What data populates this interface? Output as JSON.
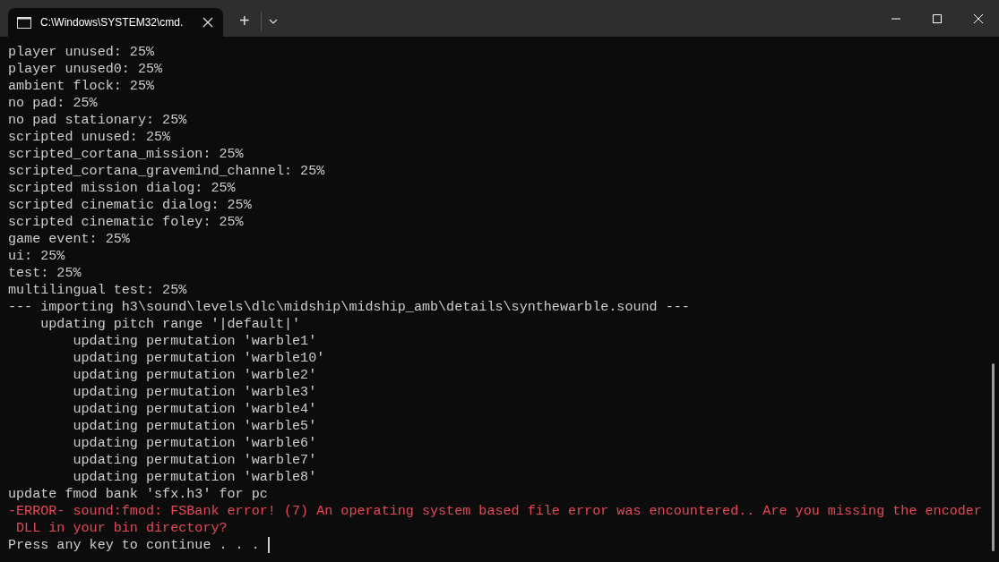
{
  "window": {
    "tab_title": "C:\\Windows\\SYSTEM32\\cmd.",
    "new_tab": "+"
  },
  "lines": [
    {
      "kind": "output",
      "text": "player unused: 25%"
    },
    {
      "kind": "output",
      "text": "player unused0: 25%"
    },
    {
      "kind": "output",
      "text": "ambient flock: 25%"
    },
    {
      "kind": "output",
      "text": "no pad: 25%"
    },
    {
      "kind": "output",
      "text": "no pad stationary: 25%"
    },
    {
      "kind": "output",
      "text": "scripted unused: 25%"
    },
    {
      "kind": "output",
      "text": "scripted_cortana_mission: 25%"
    },
    {
      "kind": "output",
      "text": "scripted_cortana_gravemind_channel: 25%"
    },
    {
      "kind": "output",
      "text": "scripted mission dialog: 25%"
    },
    {
      "kind": "output",
      "text": "scripted cinematic dialog: 25%"
    },
    {
      "kind": "output",
      "text": "scripted cinematic foley: 25%"
    },
    {
      "kind": "output",
      "text": "game event: 25%"
    },
    {
      "kind": "output",
      "text": "ui: 25%"
    },
    {
      "kind": "output",
      "text": "test: 25%"
    },
    {
      "kind": "output",
      "text": "multilingual test: 25%"
    },
    {
      "kind": "output",
      "text": "--- importing h3\\sound\\levels\\dlc\\midship\\midship_amb\\details\\synthewarble.sound ---"
    },
    {
      "kind": "output",
      "text": "    updating pitch range '|default|'"
    },
    {
      "kind": "output",
      "text": "        updating permutation 'warble1'"
    },
    {
      "kind": "output",
      "text": "        updating permutation 'warble10'"
    },
    {
      "kind": "output",
      "text": "        updating permutation 'warble2'"
    },
    {
      "kind": "output",
      "text": "        updating permutation 'warble3'"
    },
    {
      "kind": "output",
      "text": "        updating permutation 'warble4'"
    },
    {
      "kind": "output",
      "text": "        updating permutation 'warble5'"
    },
    {
      "kind": "output",
      "text": "        updating permutation 'warble6'"
    },
    {
      "kind": "output",
      "text": "        updating permutation 'warble7'"
    },
    {
      "kind": "output",
      "text": "        updating permutation 'warble8'"
    },
    {
      "kind": "output",
      "text": "update fmod bank 'sfx.h3' for pc"
    },
    {
      "kind": "error",
      "text": "-ERROR- sound:fmod: FSBank error! (7) An operating system based file error was encountered.. Are you missing the encoder"
    },
    {
      "kind": "error",
      "text": " DLL in your bin directory?"
    },
    {
      "kind": "prompt",
      "text": "Press any key to continue . . . "
    }
  ]
}
